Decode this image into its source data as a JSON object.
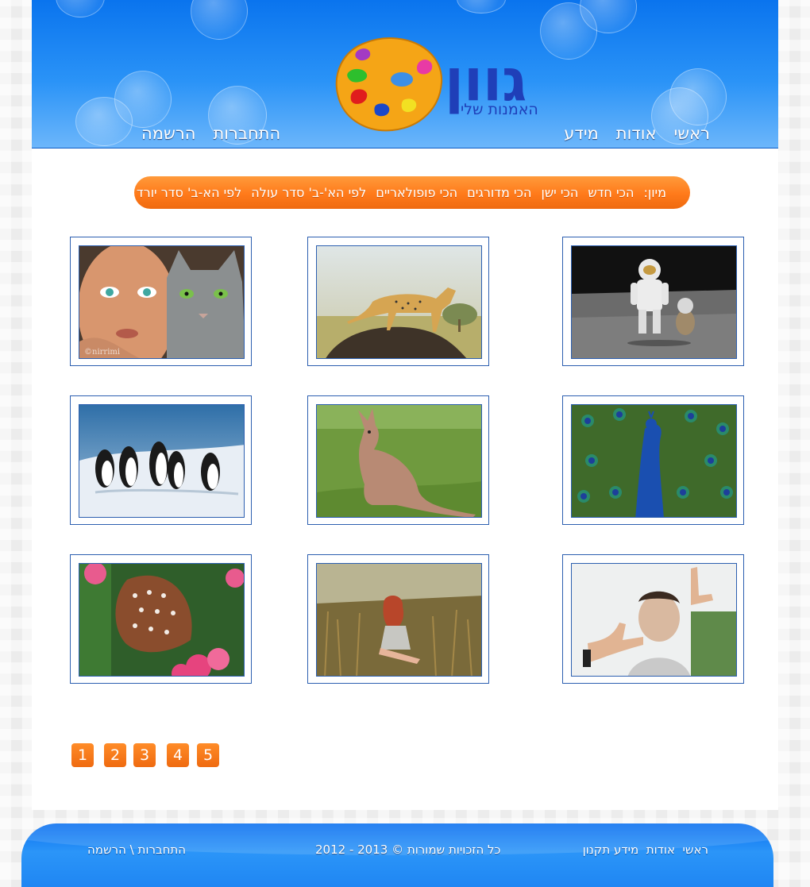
{
  "brand": {
    "title": "גוון",
    "subtitle": "האמנות שלי"
  },
  "nav": {
    "home": "ראשי",
    "about": "אודות",
    "info": "מידע",
    "login": "התחברות",
    "register": "הרשמה"
  },
  "sort": {
    "label": "מיון:",
    "options": [
      "הכי חדש",
      "הכי ישן",
      "הכי מדורגים",
      "הכי פופולאריים",
      "לפי הא'-ב' סדר עולה",
      "לפי הא-ב' סדר יורד"
    ]
  },
  "gallery": [
    {
      "subject": "girl-with-cat",
      "watermark": "©nirrimi"
    },
    {
      "subject": "cheetah"
    },
    {
      "subject": "astronaut-on-moon"
    },
    {
      "subject": "penguins"
    },
    {
      "subject": "wallaby"
    },
    {
      "subject": "peacock"
    },
    {
      "subject": "butterfly"
    },
    {
      "subject": "girl-in-field"
    },
    {
      "subject": "hand-frame-portrait"
    }
  ],
  "pagination": [
    "1",
    "2",
    "3",
    "4",
    "5"
  ],
  "footer": {
    "home": "ראשי",
    "about": "אודות",
    "info_regulations": "מידע תקנון",
    "copyright": "כל הזכויות שמורות © 2013 - 2012",
    "login": "התחברות",
    "separator": "\\",
    "register": "הרשמה"
  },
  "colors": {
    "header_blue": "#1a84f4",
    "accent_orange": "#ff7a1a",
    "frame_border": "#2c5fb0"
  }
}
